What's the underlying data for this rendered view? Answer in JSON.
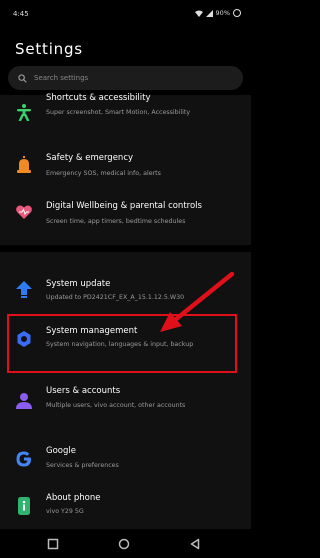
{
  "status": {
    "time": "4:45",
    "battery": "90%"
  },
  "page": {
    "title": "Settings"
  },
  "search": {
    "placeholder": "Search settings"
  },
  "items": [
    {
      "title": "Shortcuts & accessibility",
      "subtitle": "Super screenshot, Smart Motion, Accessibility",
      "icon": "accessibility-icon",
      "color": "#3bd16f"
    },
    {
      "title": "Safety & emergency",
      "subtitle": "Emergency SOS, medical info, alerts",
      "icon": "emergency-icon",
      "color": "#f08a24"
    },
    {
      "title": "Digital Wellbeing & parental controls",
      "subtitle": "Screen time, app timers, bedtime schedules",
      "icon": "heart-icon",
      "color": "#e8587a"
    },
    {
      "title": "System update",
      "subtitle": "Updated to PD2421CF_EX_A_15.1.12.5.W30",
      "icon": "update-arrow-icon",
      "color": "#2d7cf6"
    },
    {
      "title": "System management",
      "subtitle": "System navigation, languages & input, backup",
      "icon": "gear-icon",
      "color": "#3b6cf6"
    },
    {
      "title": "Users & accounts",
      "subtitle": "Multiple users, vivo account, other accounts",
      "icon": "user-icon",
      "color": "#8a5cf0"
    },
    {
      "title": "Google",
      "subtitle": "Services & preferences",
      "icon": "google-icon",
      "color": "#4285f4"
    },
    {
      "title": "About phone",
      "subtitle": "vivo Y29 5G",
      "icon": "phone-info-icon",
      "color": "#2fb36e"
    }
  ],
  "annotation": {
    "color": "#e0101a"
  }
}
